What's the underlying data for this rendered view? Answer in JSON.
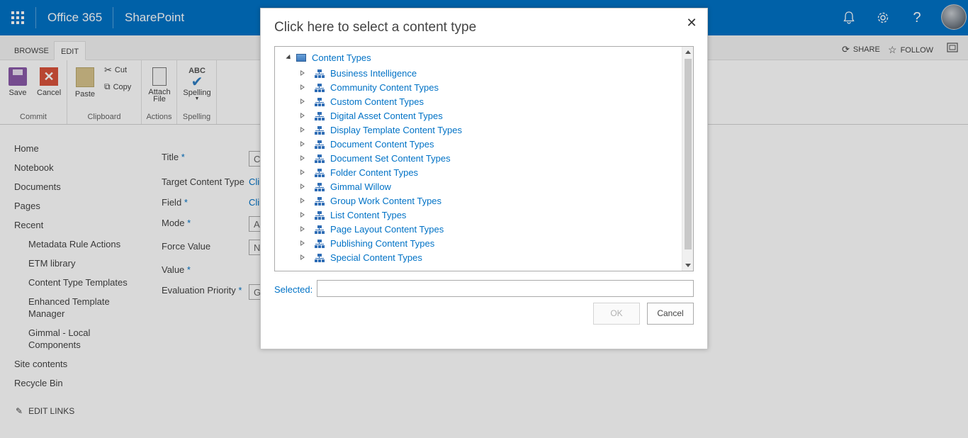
{
  "suitebar": {
    "brand": "Office 365",
    "app": "SharePoint",
    "icons": [
      "bell-icon",
      "gear-icon",
      "help-icon"
    ]
  },
  "ribbon": {
    "tabs": [
      "BROWSE",
      "EDIT"
    ],
    "active_tab": "EDIT",
    "actions": {
      "share": "SHARE",
      "follow": "FOLLOW"
    },
    "groups": {
      "commit": {
        "label": "Commit",
        "save": "Save",
        "cancel": "Cancel"
      },
      "clipboard": {
        "label": "Clipboard",
        "paste": "Paste",
        "cut": "Cut",
        "copy": "Copy"
      },
      "actions": {
        "label": "Actions",
        "attach_line1": "Attach",
        "attach_line2": "File"
      },
      "spelling": {
        "label": "Spelling",
        "abc": "ABC",
        "spelling": "Spelling"
      }
    }
  },
  "leftnav": {
    "items": [
      "Home",
      "Notebook",
      "Documents",
      "Pages",
      "Recent"
    ],
    "recent": [
      "Metadata Rule Actions",
      "ETM library",
      "Content Type Templates",
      "Enhanced Template Manager",
      "Gimmal - Local Components"
    ],
    "bottom": [
      "Site contents",
      "Recycle Bin"
    ],
    "edit_links": "EDIT LINKS"
  },
  "form": {
    "title_label": "Title",
    "target_label": "Target Content Type",
    "field_label": "Field",
    "mode_label": "Mode",
    "force_label": "Force Value",
    "value_label": "Value",
    "priority_label": "Evaluation Priority",
    "required_mark": "*",
    "title_value": "C",
    "target_link": "Cli",
    "field_link": "Cli",
    "mode_value": "Al",
    "force_value": "N",
    "priority_value": "G"
  },
  "dialog": {
    "title": "Click here to select a content type",
    "close": "✕",
    "root": "Content Types",
    "items": [
      "Business Intelligence",
      "Community Content Types",
      "Custom Content Types",
      "Digital Asset Content Types",
      "Display Template Content Types",
      "Document Content Types",
      "Document Set Content Types",
      "Folder Content Types",
      "Gimmal Willow",
      "Group Work Content Types",
      "List Content Types",
      "Page Layout Content Types",
      "Publishing Content Types",
      "Special Content Types"
    ],
    "selected_label": "Selected:",
    "selected_value": "",
    "ok": "OK",
    "cancel": "Cancel"
  },
  "colors": {
    "suitebar": "#0072c6",
    "link": "#0072c6"
  }
}
